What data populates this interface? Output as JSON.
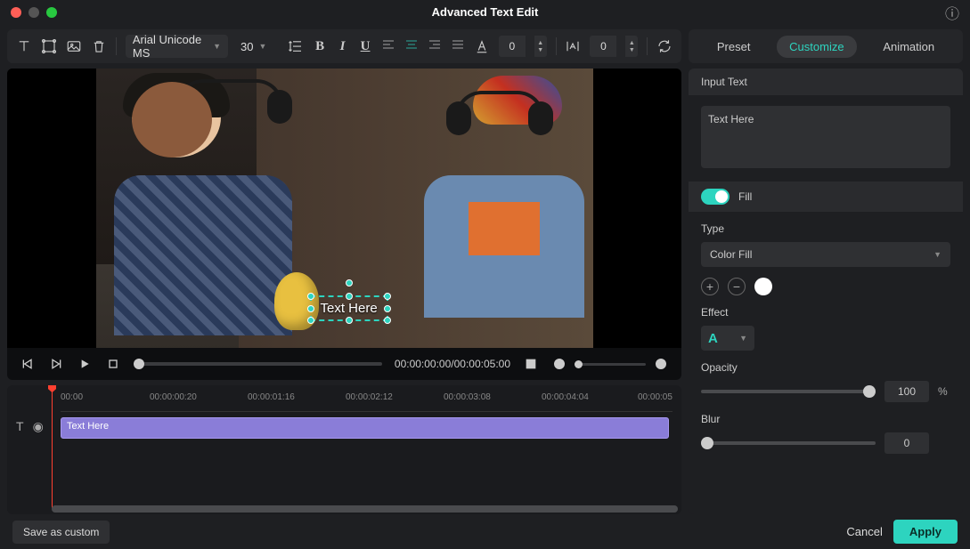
{
  "title": "Advanced Text Edit",
  "toolbar": {
    "font": "Arial Unicode MS",
    "size": "30",
    "tracking": "0",
    "leading": "0"
  },
  "preview": {
    "text_overlay": "Text Here",
    "timecode": "00:00:00:00/00:00:05:00"
  },
  "timeline": {
    "marks": [
      "00:00",
      "00:00:00:20",
      "00:00:01:16",
      "00:00:02:12",
      "00:00:03:08",
      "00:00:04:04",
      "00:00:05"
    ],
    "clip_label": "Text Here"
  },
  "right": {
    "tabs": {
      "preset": "Preset",
      "customize": "Customize",
      "animation": "Animation"
    },
    "input_section": "Input Text",
    "input_value": "Text Here",
    "fill_label": "Fill",
    "type_label": "Type",
    "type_value": "Color Fill",
    "effect_label": "Effect",
    "effect_value": "A",
    "opacity_label": "Opacity",
    "opacity_value": "100",
    "opacity_unit": "%",
    "blur_label": "Blur",
    "blur_value": "0"
  },
  "footer": {
    "save_custom": "Save as custom",
    "cancel": "Cancel",
    "apply": "Apply"
  }
}
